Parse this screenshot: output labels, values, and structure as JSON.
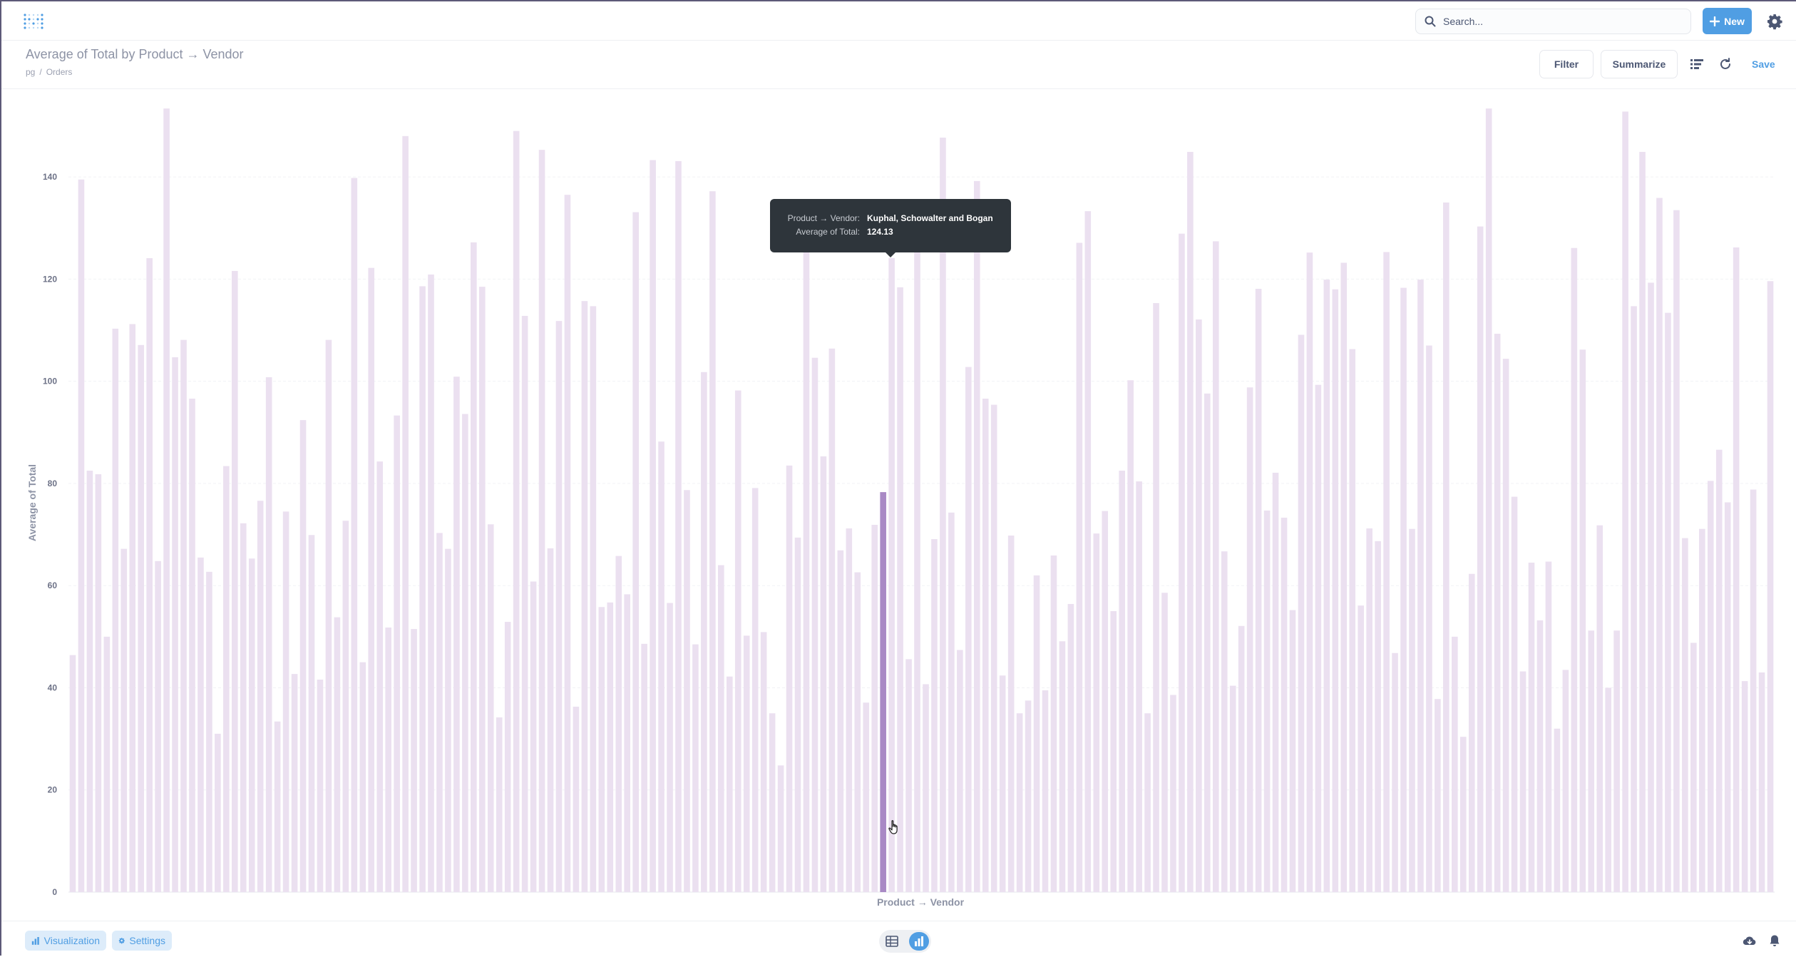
{
  "nav": {
    "search_placeholder": "Search...",
    "new_label": "New"
  },
  "header": {
    "title": "Average of Total by Product → Vendor",
    "breadcrumb": [
      "pg",
      "Orders"
    ],
    "filter_label": "Filter",
    "summarize_label": "Summarize",
    "save_label": "Save"
  },
  "tooltip": {
    "dimension_key": "Product → Vendor:",
    "dimension_value": "Kuphal, Schowalter and Bogan",
    "metric_key": "Average of Total:",
    "metric_value": "124.13"
  },
  "footer": {
    "visualization_label": "Visualization",
    "settings_label": "Settings"
  },
  "colors": {
    "accent": "#509ee3",
    "bar": "#ebe0f0",
    "bar_highlight": "#a989c5"
  },
  "chart_data": {
    "type": "bar",
    "xlabel": "Product → Vendor",
    "ylabel": "Average of Total",
    "ylim": [
      0,
      153
    ],
    "yticks": [
      0,
      20,
      40,
      60,
      80,
      100,
      120,
      140
    ],
    "grid": true,
    "highlight_index": 95,
    "values": [
      46.4,
      139.5,
      82.5,
      81.8,
      50.0,
      110.3,
      67.2,
      111.2,
      107.1,
      124.1,
      64.8,
      153.4,
      104.7,
      108.1,
      96.6,
      65.5,
      62.7,
      31.0,
      83.4,
      121.6,
      72.2,
      65.3,
      76.6,
      100.8,
      33.4,
      74.5,
      42.7,
      92.4,
      69.9,
      41.6,
      108.1,
      53.8,
      72.7,
      139.8,
      45.0,
      122.2,
      84.3,
      51.8,
      93.3,
      148.0,
      51.5,
      118.6,
      120.9,
      70.3,
      67.2,
      100.9,
      93.6,
      127.2,
      118.5,
      72.0,
      34.2,
      52.9,
      149.0,
      112.8,
      60.8,
      145.3,
      67.3,
      111.8,
      136.5,
      36.3,
      115.7,
      114.7,
      55.8,
      56.7,
      65.8,
      58.3,
      133.1,
      48.6,
      143.3,
      88.2,
      56.6,
      143.1,
      78.7,
      48.5,
      101.8,
      137.2,
      64.0,
      42.2,
      98.2,
      50.2,
      79.1,
      50.9,
      35.0,
      24.8,
      83.5,
      69.4,
      127.2,
      104.6,
      85.3,
      106.4,
      66.9,
      71.2,
      62.6,
      37.1,
      71.9,
      78.3,
      124.13,
      118.4,
      45.6,
      130.1,
      40.7,
      69.1,
      147.7,
      74.3,
      47.4,
      102.8,
      139.2,
      96.6,
      95.4,
      42.4,
      69.8,
      35.0,
      37.5,
      62.0,
      39.5,
      65.9,
      49.1,
      56.4,
      127.1,
      133.3,
      70.2,
      74.6,
      55.0,
      82.5,
      100.2,
      80.4,
      35.0,
      115.3,
      58.6,
      38.6,
      128.9,
      144.9,
      112.1,
      97.6,
      127.4,
      66.7,
      40.4,
      52.1,
      98.8,
      118.1,
      74.7,
      82.1,
      73.3,
      55.2,
      109.1,
      125.2,
      99.3,
      119.9,
      118.0,
      123.2,
      106.3,
      56.1,
      71.2,
      68.7,
      125.3,
      46.8,
      118.3,
      71.1,
      119.9,
      107.0,
      37.8,
      135.0,
      50.0,
      30.4,
      62.3,
      130.3,
      153.4,
      109.3,
      104.4,
      77.4,
      43.2,
      64.5,
      53.2,
      64.7,
      32.0,
      43.5,
      126.1,
      106.2,
      51.2,
      71.8,
      40.0,
      51.2,
      152.8,
      114.7,
      144.9,
      119.3,
      135.9,
      113.4,
      133.5,
      69.3,
      48.8,
      71.1,
      80.5,
      86.6,
      76.3,
      126.2,
      41.3,
      78.8,
      43.0,
      119.6
    ]
  }
}
